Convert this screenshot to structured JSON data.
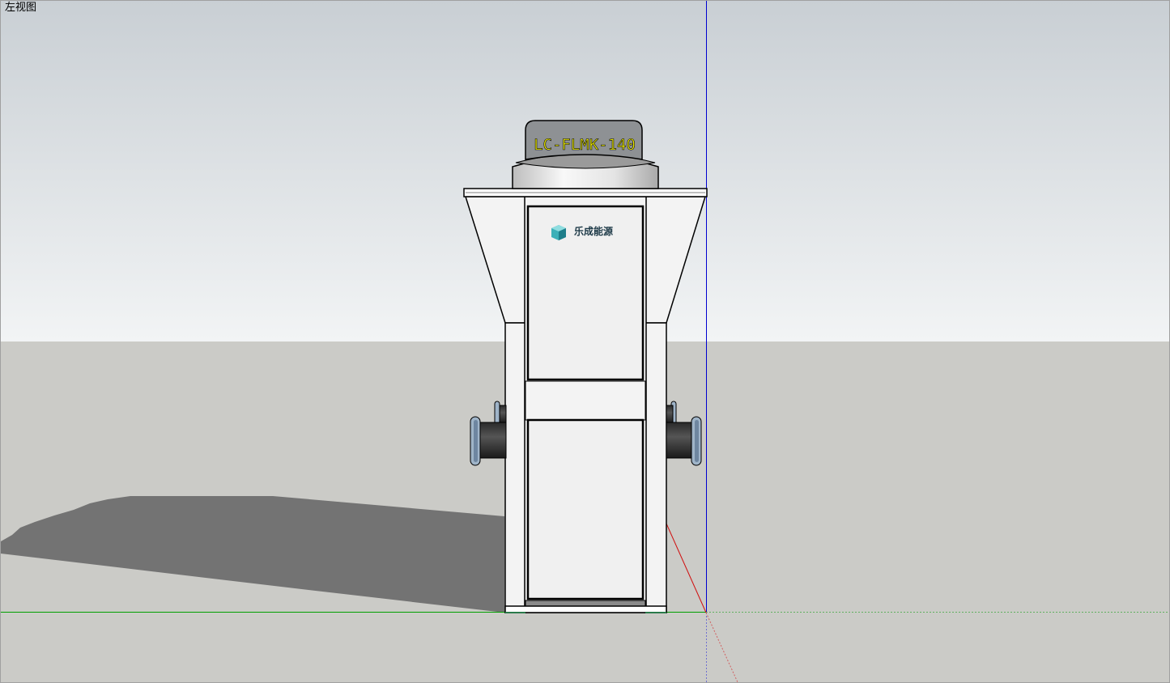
{
  "viewport": {
    "view_name": "左视图"
  },
  "unit": {
    "model_label": "LC-FLMK-140",
    "brand_name": "乐成能源"
  },
  "colors": {
    "sky_top": "#c9cfd4",
    "sky_bottom": "#f2f4f5",
    "ground": "#cbcbc7",
    "shadow": "#737373",
    "axis_blue": "#0000d0",
    "axis_green": "#00a000",
    "axis_red": "#d01010",
    "model_label_text": "#f2f000",
    "logo_cube": "#3cb0b8"
  }
}
